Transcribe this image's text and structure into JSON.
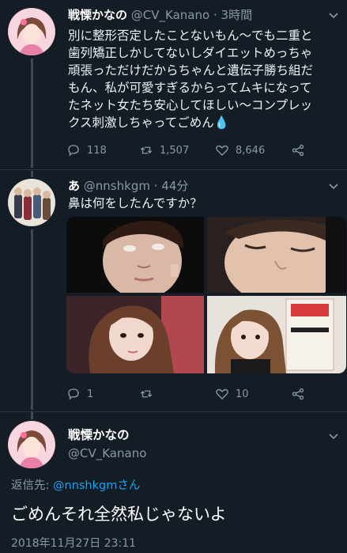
{
  "tweet1": {
    "display_name": "戦慄かなの",
    "handle": "@CV_Kanano",
    "separator": "·",
    "time_ago": "3時間",
    "lines": [
      "別に整形否定したことないもん〜でも二重と",
      "歯列矯正しかしてないしダイエットめっちゃ",
      "頑張っただけだからちゃんと遺伝子勝ち組だ",
      "もん、私が可愛すぎるからってムキになって",
      "たネット女たち安心してほしい〜コンプレッ",
      "クス刺激しちゃってごめん"
    ],
    "emoji": "💧",
    "replies": "118",
    "retweets": "1,507",
    "likes": "8,646"
  },
  "tweet2": {
    "display_name": "あ",
    "handle": "@nnshkgm",
    "separator": "·",
    "time_ago": "44分",
    "text": "鼻は何をしたんですか？",
    "replies": "1",
    "retweets": "",
    "likes": "10"
  },
  "tweet3": {
    "display_name": "戦慄かなの",
    "handle": "@CV_Kanano",
    "reply_prefix": "返信先:",
    "reply_handle": "@nnshkgmさん",
    "text": "ごめんそれ全然私じゃないよ",
    "timestamp": "2018年11月27日 23:11"
  },
  "colors": {
    "background": "#141d26",
    "secondary_text": "#8899a6",
    "link": "#1da1f2",
    "divider": "#2a3744"
  },
  "icons": [
    "reply-icon",
    "retweet-icon",
    "like-icon",
    "share-icon",
    "chevron-down-icon"
  ]
}
